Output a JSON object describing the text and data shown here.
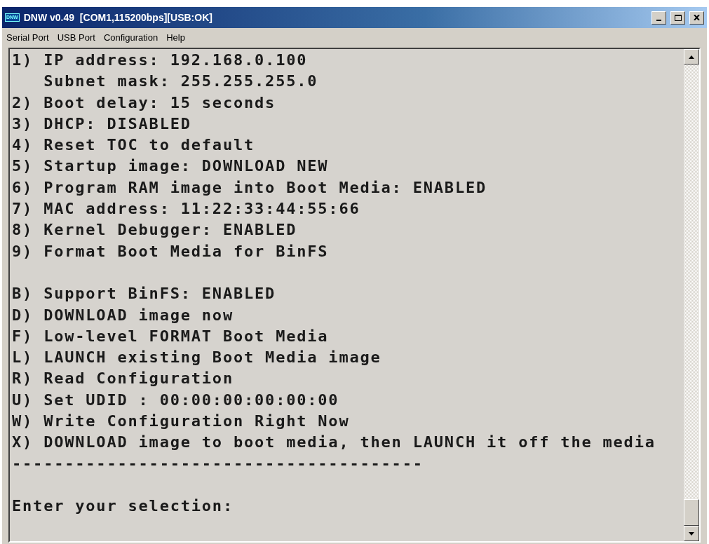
{
  "window": {
    "title": "DNW v0.49  [COM1,115200bps][USB:OK]",
    "app_icon_text": "DNW"
  },
  "menu": [
    "Serial Port",
    "USB Port",
    "Configuration",
    "Help"
  ],
  "terminal": {
    "groups": [
      [
        "1) IP address: 192.168.0.100",
        "   Subnet mask: 255.255.255.0",
        "2) Boot delay: 15 seconds",
        "3) DHCP: DISABLED",
        "4) Reset TOC to default",
        "5) Startup image: DOWNLOAD NEW",
        "6) Program RAM image into Boot Media: ENABLED",
        "7) MAC address: 11:22:33:44:55:66",
        "8) Kernel Debugger: ENABLED",
        "9) Format Boot Media for BinFS"
      ],
      [
        "B) Support BinFS: ENABLED",
        "D) DOWNLOAD image now",
        "F) Low-level FORMAT Boot Media",
        "L) LAUNCH existing Boot Media image",
        "R) Read Configuration",
        "U) Set UDID : 00:00:00:00:00:00",
        "W) Write Configuration Right Now",
        "X) DOWNLOAD image to boot media, then LAUNCH it off the media",
        "---------------------------------------"
      ],
      [
        "Enter your selection:"
      ]
    ]
  }
}
